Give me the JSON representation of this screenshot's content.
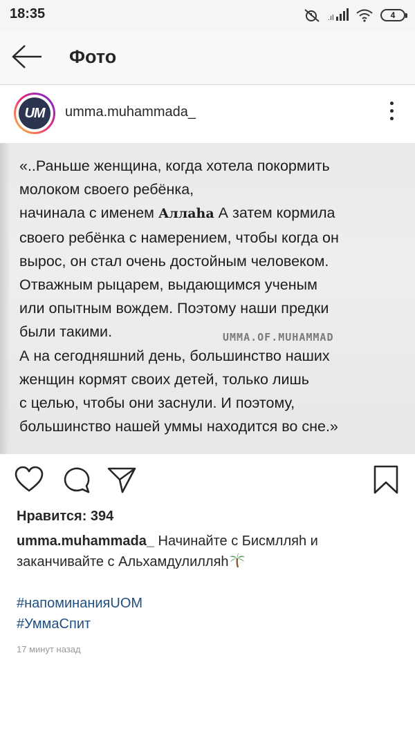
{
  "status_bar": {
    "time": "18:35",
    "battery_level": "4"
  },
  "header": {
    "title": "Фото"
  },
  "post": {
    "username": "umma.muhammada_",
    "avatar_text": "UM",
    "image_text_lines": [
      "«..Раньше женщина, когда хотела покормить",
      "молоком своего ребёнка,",
      "начинала с именем",
      "Аллаhа",
      "А затем кормила",
      "своего ребёнка с намерением, чтобы когда он",
      "вырос, он стал очень достойным человеком.",
      "Отважным рыцарем, выдающимся ученым",
      "или опытным вождем. Поэтому наши предки",
      "были такими.",
      "А на сегодняшний день, большинство наших",
      "женщин кормят своих детей, только лишь",
      "с целью, чтобы они заснули. И поэтому,",
      "большинство нашей уммы находится во сне.»"
    ],
    "watermark": "UMMA.OF.MUHAMMAD",
    "likes": "Нравится: 394",
    "caption_username": "umma.muhammada_",
    "caption_text": " Начинайте с Бисмлляh и заканчивайте с Альхамдулилляh",
    "hashtags": [
      "#напоминанияUOM",
      "#УммаСпит"
    ],
    "timestamp": "17 минут назад"
  },
  "icons": {
    "back": "arrow-left-icon",
    "more": "more-vertical-icon",
    "like": "heart-icon",
    "comment": "comment-icon",
    "share": "send-icon",
    "save": "bookmark-icon",
    "caption_emoji": "palm-tree-icon"
  },
  "colors": {
    "hashtag": "#1e4f80",
    "avatar_ring_start": "#f9ce34",
    "avatar_ring_mid": "#ee2a7b",
    "avatar_ring_end": "#6228d7",
    "avatar_fill": "#2c3550"
  }
}
